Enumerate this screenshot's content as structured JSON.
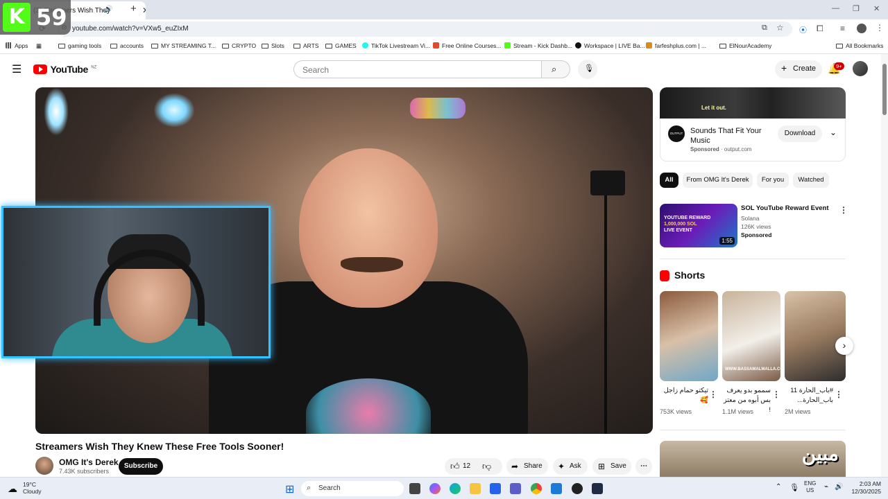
{
  "browser": {
    "tab_title": "(3) Streamers Wish They",
    "url": "youtube.com/watch?v=VXw5_euZIxM"
  },
  "overlay": {
    "viewer_count": "59"
  },
  "bookmarks": [
    "Apps",
    "gaming tools",
    "accounts",
    "MY STREAMING T...",
    "CRYPTO",
    "Slots",
    "ARTS",
    "GAMES",
    "TikTok Livestream Vi...",
    "Free Online Courses...",
    "Stream - Kick Dashb...",
    "Workspace | LIVE Ba...",
    "farfeshplus.com | ...",
    "ElNourAcademy",
    "All Bookmarks"
  ],
  "youtube": {
    "logo_text": "YouTube",
    "region": "NZ",
    "search_placeholder": "Search",
    "create_label": "Create",
    "notification_count": "9+"
  },
  "video": {
    "title": "Streamers Wish They Knew These Free Tools Sooner!",
    "channel": "OMG It's Derek",
    "subscribers": "7.43K subscribers",
    "subscribe_label": "Subscribe",
    "likes": "12",
    "share_label": "Share",
    "ask_label": "Ask",
    "save_label": "Save"
  },
  "ad": {
    "banner_text": "Let it out.",
    "logo_text": "OUTPUT",
    "title": "Sounds That Fit Your Music",
    "sponsored_label": "Sponsored",
    "domain": "output.com",
    "download_label": "Download"
  },
  "chips": [
    "All",
    "From OMG It's Derek",
    "For you",
    "Watched"
  ],
  "sponsored_video": {
    "title": "SOL YouTube Reward Event",
    "channel": "Solana",
    "views": "126K views",
    "label": "Sponsored",
    "duration": "1:55",
    "thumb_text_1": "YOUTUBE REWARD",
    "thumb_text_2": "1,000,000 SOL",
    "thumb_text_3": "LIVE EVENT"
  },
  "shorts": {
    "section_title": "Shorts",
    "items": [
      {
        "title": "تيكتو حمام زاجل 🥰",
        "views": "753K views"
      },
      {
        "title": "سممو بدو يعرف بس أبوه من معتز !",
        "views": "1.1M views"
      },
      {
        "title": "#باب_الحارة 11 باب_الحارة...",
        "views": "2M views"
      }
    ]
  },
  "bottom_thumb_text": "مبين",
  "taskbar": {
    "temperature": "19°C",
    "condition": "Cloudy",
    "search_label": "Search",
    "lang_1": "ENG",
    "lang_2": "US",
    "time": "2:03 AM",
    "date": "12/30/2025"
  }
}
